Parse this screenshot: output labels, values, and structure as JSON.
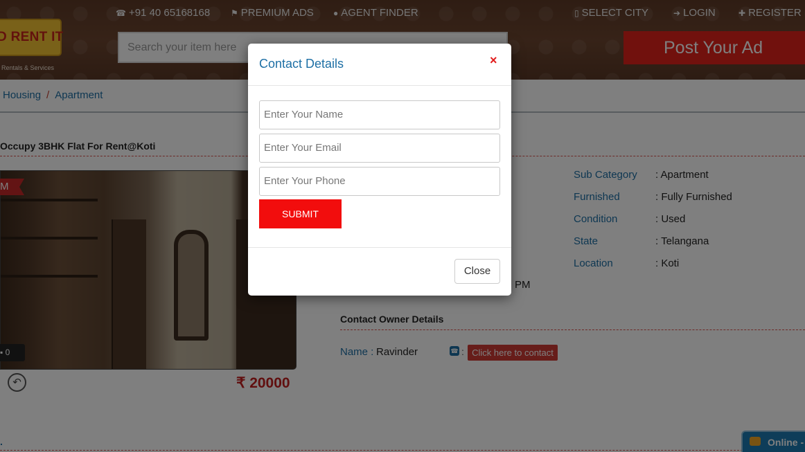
{
  "header": {
    "logo_text": "D RENT IT",
    "logo_sub": "Rentals & Services",
    "phone": "+91 40 65168168",
    "premium_ads": "PREMIUM ADS",
    "agent_finder": "AGENT FINDER",
    "select_city": "SELECT CITY",
    "login": "LOGIN",
    "register": "REGISTER",
    "search_placeholder": "Search your item here",
    "post_ad": "Post Your Ad",
    "colors": {
      "brand_bg": "#6d4630",
      "accent": "#e2231a",
      "logo": "#f2c232"
    }
  },
  "breadcrumb": {
    "items": [
      "Housing",
      "Apartment"
    ],
    "separator": "/"
  },
  "listing": {
    "title": "Occupy 3BHK Flat For Rent@Koti",
    "ribbon": "M",
    "photo_count": "0",
    "price": "₹ 20000",
    "time_fragment": "PM",
    "details": [
      {
        "label": "Sub Category",
        "value": ": Apartment"
      },
      {
        "label": "Furnished",
        "value": ": Fully Furnished"
      },
      {
        "label": "Condition",
        "value": ": Used"
      },
      {
        "label": "State",
        "value": ": Telangana"
      },
      {
        "label": "Location",
        "value": ": Koti"
      }
    ],
    "owner": {
      "heading": "Contact Owner Details",
      "name_label": "Name :",
      "name_value": "Ravinder",
      "contact_button": "Click here to contact"
    }
  },
  "chat": {
    "label": "Online -"
  },
  "modal": {
    "title": "Contact Details",
    "close_x": "×",
    "name_placeholder": "Enter Your Name",
    "email_placeholder": "Enter Your Email",
    "phone_placeholder": "Enter Your Phone",
    "submit_label": "SUBMIT",
    "close_label": "Close"
  },
  "icons": [
    "phone-icon",
    "flag-icon",
    "user-icon",
    "building-icon",
    "login-icon",
    "user-plus-icon",
    "camera-icon",
    "back-icon",
    "chat-bubble-icon"
  ]
}
